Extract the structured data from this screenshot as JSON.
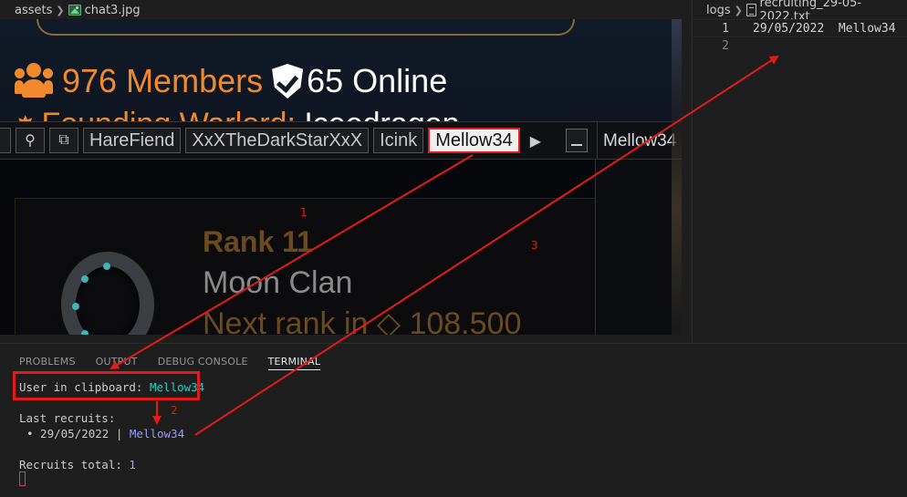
{
  "left_breadcrumb": {
    "folder": "assets",
    "file": "chat3.jpg"
  },
  "game": {
    "members": "976 Members",
    "online": "65 Online",
    "warlord_label": "Founding Warlord:",
    "warlord_name": "Iceedragon",
    "tabs": [
      "HareFiend",
      "XxXTheDarkStarXxX",
      "Icink",
      "Mellow34"
    ],
    "active_tab": "Mellow34",
    "right_tab": "Mellow34",
    "rank": "Rank 11",
    "clan": "Moon Clan",
    "next_rank": "Next rank in ◇ 108.500"
  },
  "right_breadcrumb": {
    "folder": "logs",
    "file": "recruiting_29-05-2022.txt"
  },
  "log_lines": [
    {
      "n": "1",
      "text": "29/05/2022  Mellow34"
    },
    {
      "n": "2",
      "text": ""
    }
  ],
  "panel_tabs": [
    "PROBLEMS",
    "OUTPUT",
    "DEBUG CONSOLE",
    "TERMINAL"
  ],
  "active_panel_tab": "TERMINAL",
  "terminal": {
    "clip_prefix": "User in clipboard: ",
    "clip_user": "Mellow34",
    "recruits_title": "Last recruits:",
    "recruit_bullet": "• 29/05/2022 | ",
    "recruit_user": "Mellow34",
    "total_prefix": "Recruits total: ",
    "total_value": "1"
  },
  "annotations": {
    "step1": "1",
    "step2": "2",
    "step3": "3"
  },
  "colors": {
    "annotation": "#e31b1b",
    "terminal_cyan": "#29d1c4",
    "terminal_blue": "#9a9cff"
  },
  "icons": [
    "image-icon",
    "file-text-icon",
    "people-icon",
    "shield-check-icon",
    "star-icon",
    "chevron-right-icon"
  ]
}
